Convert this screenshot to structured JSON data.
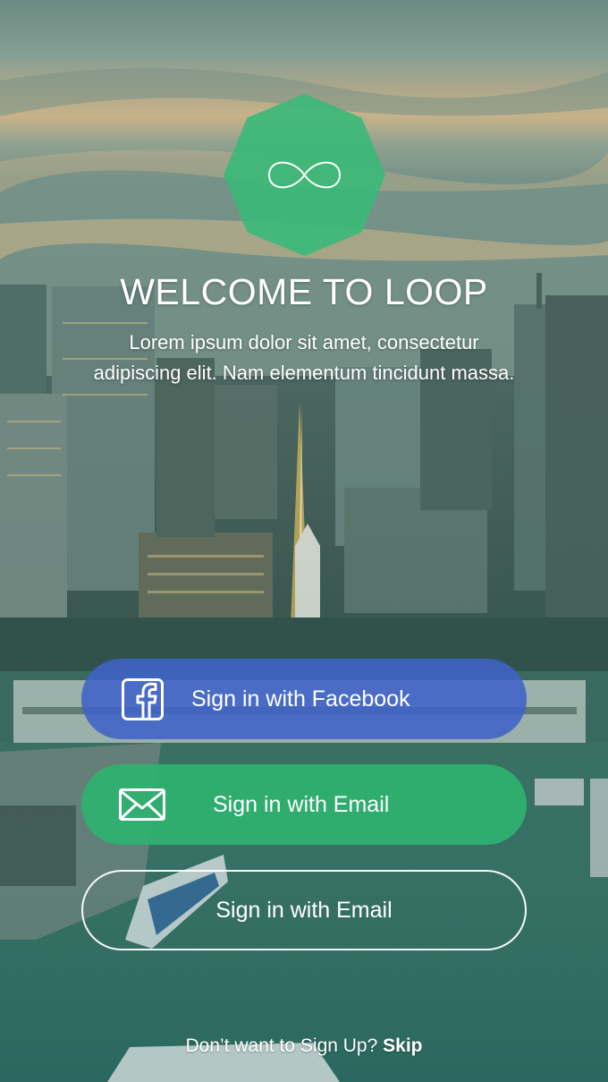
{
  "colors": {
    "brand_green": "#3cb878",
    "facebook_blue": "#3f62c8",
    "email_green": "#2eb270",
    "text": "#ffffff"
  },
  "background": {
    "image": "city-skyline-photo"
  },
  "logo": {
    "icon": "infinity-icon"
  },
  "welcome": {
    "title": "WELCOME TO LOOP",
    "subtitle": "Lorem ipsum dolor sit amet, consectetur adipiscing elit. Nam elementum tincidunt massa."
  },
  "buttons": {
    "facebook": {
      "label": "Sign in with Facebook",
      "icon": "facebook-icon"
    },
    "email": {
      "label": "Sign in with Email",
      "icon": "mail-icon"
    },
    "email_outline": {
      "label": "Sign in with Email"
    }
  },
  "footer": {
    "prompt": "Don’t want to Sign Up?",
    "skip": "Skip"
  }
}
